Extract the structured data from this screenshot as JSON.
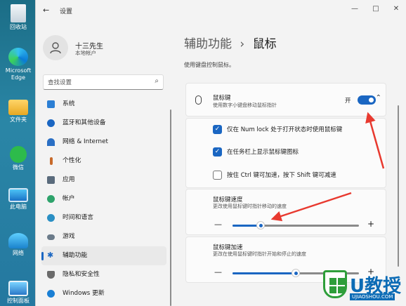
{
  "desktop": {
    "icons": [
      {
        "label": "回收站",
        "icon": "recycle-bin-icon"
      },
      {
        "label": "Microsoft Edge",
        "icon": "edge-icon"
      },
      {
        "label": "文件夹",
        "icon": "folder-icon"
      },
      {
        "label": "微信",
        "icon": "wechat-icon"
      },
      {
        "label": "此电脑",
        "icon": "pc-icon"
      },
      {
        "label": "网络",
        "icon": "network-icon"
      },
      {
        "label": "控制面板",
        "icon": "control-panel-icon"
      }
    ]
  },
  "window": {
    "title": "设置",
    "back_glyph": "←",
    "controls": {
      "minimize": "—",
      "maximize": "□",
      "close": "✕"
    }
  },
  "user": {
    "name": "十三先生",
    "account": "本地帐户"
  },
  "search": {
    "placeholder": "查找设置"
  },
  "nav": {
    "items": [
      {
        "label": "系统",
        "color": "#2c7fd4"
      },
      {
        "label": "蓝牙和其他设备",
        "color": "#1a66c2"
      },
      {
        "label": "网络 & Internet",
        "color": "#2a6fc4"
      },
      {
        "label": "个性化",
        "color": "#c86a2a"
      },
      {
        "label": "应用",
        "color": "#5a6b7c"
      },
      {
        "label": "帐户",
        "color": "#2ea36b"
      },
      {
        "label": "时间和语言",
        "color": "#2a8fc4"
      },
      {
        "label": "游戏",
        "color": "#6b7b8a"
      },
      {
        "label": "辅助功能",
        "color": "#1a66c2",
        "active": true
      },
      {
        "label": "隐私和安全性",
        "color": "#6b6b6b"
      },
      {
        "label": "Windows 更新",
        "color": "#1a7fd4"
      }
    ]
  },
  "page": {
    "breadcrumb_parent": "辅助功能",
    "breadcrumb_sep": "›",
    "breadcrumb_current": "鼠标",
    "description": "使用键盘控制鼠标。"
  },
  "mouse_keys": {
    "title": "鼠标键",
    "subtitle": "使用数字小键盘移动鼠标指针",
    "state": "开",
    "enabled": true
  },
  "options": [
    {
      "label": "仅在 Num lock 处于打开状态时使用鼠标键",
      "checked": true
    },
    {
      "label": "在任务栏上显示鼠标键图标",
      "checked": true
    },
    {
      "label": "按住 Ctrl 键可加速，按下 Shift 键可减速",
      "checked": false
    }
  ],
  "sliders": [
    {
      "title": "鼠标键速度",
      "subtitle": "更改使用鼠标键时指针移动的速度",
      "value_fraction": 0.22
    },
    {
      "title": "鼠标键加速",
      "subtitle": "更改在使用鼠标键时指针开始和停止的速度",
      "value_fraction": 0.5
    }
  ],
  "slider_minus": "—",
  "slider_plus": "+",
  "watermark": {
    "brand": "U教授",
    "url": "UJIAOSHOU.COM"
  },
  "colors": {
    "accent": "#1a66c2",
    "arrow": "#e8392f"
  }
}
